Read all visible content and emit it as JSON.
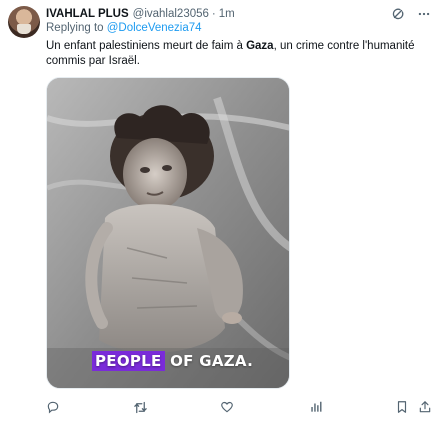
{
  "author": {
    "display_name": "IVAHLAL PLUS",
    "handle": "@ivahlal23056",
    "separator": "·",
    "time": "1m"
  },
  "reply": {
    "prefix": "Replying to",
    "mention": "@DolceVenezia74"
  },
  "tweet": {
    "text_before": "Un enfant palestiniens meurt de faim à ",
    "text_bold": "Gaza",
    "text_after": ", un crime contre l'humanité commis par Israël."
  },
  "media": {
    "caption_highlight": "PEOPLE",
    "caption_rest": " OF GAZA."
  },
  "icons": {
    "grok": "grok-icon",
    "more": "more-icon",
    "reply": "reply-icon",
    "repost": "repost-icon",
    "like": "like-icon",
    "views": "views-icon",
    "bookmark": "bookmark-icon",
    "share": "share-icon"
  },
  "colors": {
    "link": "#1d9bf0",
    "muted": "#536471",
    "caption_highlight": "#7a2bd9"
  }
}
